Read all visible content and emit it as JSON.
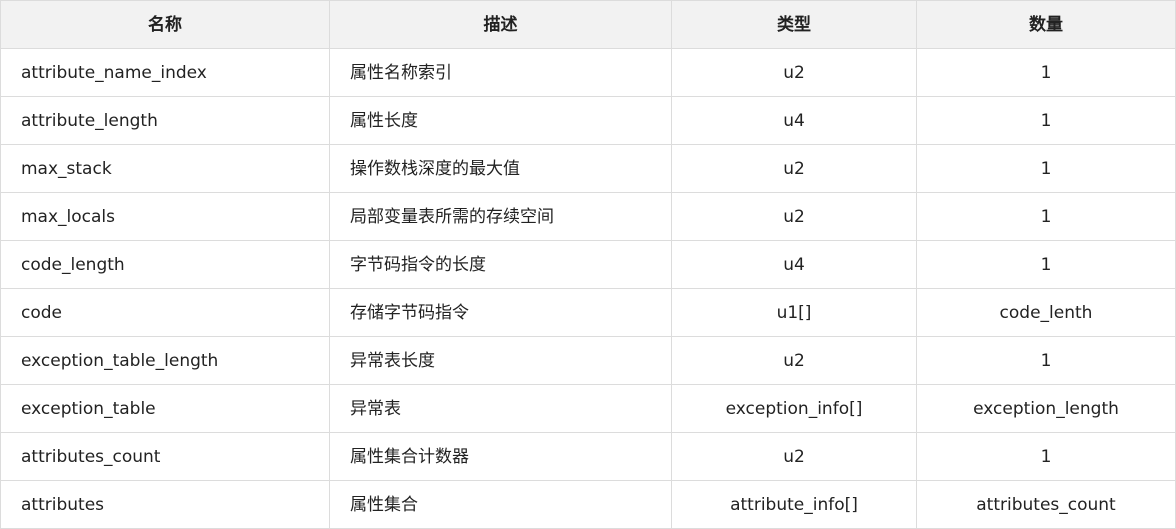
{
  "table": {
    "headers": [
      "名称",
      "描述",
      "类型",
      "数量"
    ],
    "rows": [
      [
        "attribute_name_index",
        "属性名称索引",
        "u2",
        "1"
      ],
      [
        "attribute_length",
        "属性长度",
        "u4",
        "1"
      ],
      [
        "max_stack",
        "操作数栈深度的最大值",
        "u2",
        "1"
      ],
      [
        "max_locals",
        "局部变量表所需的存续空间",
        "u2",
        "1"
      ],
      [
        "code_length",
        "字节码指令的长度",
        "u4",
        "1"
      ],
      [
        "code",
        "存储字节码指令",
        "u1[]",
        "code_lenth"
      ],
      [
        "exception_table_length",
        "异常表长度",
        "u2",
        "1"
      ],
      [
        "exception_table",
        "异常表",
        "exception_info[]",
        "exception_length"
      ],
      [
        "attributes_count",
        "属性集合计数器",
        "u2",
        "1"
      ],
      [
        "attributes",
        "属性集合",
        "attribute_info[]",
        "attributes_count"
      ]
    ]
  }
}
